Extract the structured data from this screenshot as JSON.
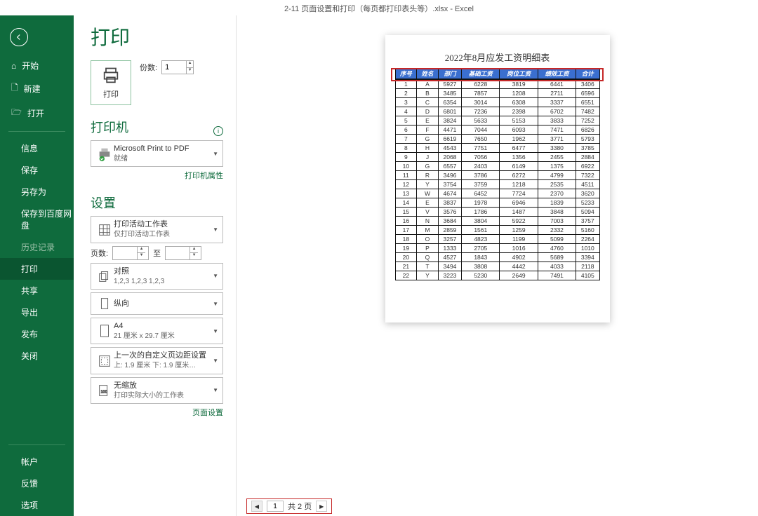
{
  "titlebar": "2-11 页面设置和打印（每页都打印表头等）.xlsx  -  Excel",
  "page_title": "打印",
  "print_btn": "打印",
  "copies_label": "份数:",
  "copies_value": "1",
  "section_printer": "打印机",
  "printer": {
    "name": "Microsoft Print to PDF",
    "status": "就绪"
  },
  "printer_props": "打印机属性",
  "section_settings": "设置",
  "dd_activesheet": {
    "t1": "打印活动工作表",
    "t2": "仅打印活动工作表"
  },
  "pages_label": "页数:",
  "pages_to": "至",
  "dd_collate": {
    "t1": "对照",
    "t2": "1,2,3    1,2,3    1,2,3"
  },
  "dd_orient": {
    "t1": "纵向"
  },
  "dd_paper": {
    "t1": "A4",
    "t2": "21 厘米 x 29.7 厘米"
  },
  "dd_margin": {
    "t1": "上一次的自定义页边距设置",
    "t2": "上: 1.9 厘米 下: 1.9 厘米…"
  },
  "dd_scale": {
    "t1": "无缩放",
    "t2": "打印实际大小的工作表"
  },
  "page_setup": "页面设置",
  "nav": {
    "start": "开始",
    "new": "新建",
    "open": "打开",
    "info": "信息",
    "save": "保存",
    "saveas": "另存为",
    "baidu": "保存到百度网盘",
    "history": "历史记录",
    "print": "打印",
    "share": "共享",
    "export": "导出",
    "publish": "发布",
    "close": "关闭",
    "account": "帐户",
    "feedback": "反馈",
    "options": "选项"
  },
  "pager": {
    "current": "1",
    "total": "共 2 页"
  },
  "chart_data": {
    "type": "table",
    "title": "2022年8月应发工资明细表",
    "columns": [
      "序号",
      "姓名",
      "部门",
      "基础工资",
      "岗位工资",
      "绩效工资",
      "合计"
    ],
    "rows": [
      [
        1,
        "A",
        5927,
        6228,
        3819,
        6441,
        3406
      ],
      [
        2,
        "B",
        3485,
        7857,
        1208,
        2711,
        6596
      ],
      [
        3,
        "C",
        6354,
        3014,
        6308,
        3337,
        6551
      ],
      [
        4,
        "D",
        6801,
        7236,
        2398,
        6702,
        7482
      ],
      [
        5,
        "E",
        3824,
        5633,
        5153,
        3833,
        7252
      ],
      [
        6,
        "F",
        4471,
        7044,
        6093,
        7471,
        6826
      ],
      [
        7,
        "G",
        6619,
        7650,
        1962,
        3771,
        5793
      ],
      [
        8,
        "H",
        4543,
        7751,
        6477,
        3380,
        3785
      ],
      [
        9,
        "J",
        2068,
        7056,
        1356,
        2455,
        2884
      ],
      [
        10,
        "G",
        6557,
        2403,
        6149,
        1375,
        6922
      ],
      [
        11,
        "R",
        3496,
        3786,
        6272,
        4799,
        7322
      ],
      [
        12,
        "Y",
        3754,
        3759,
        1218,
        2535,
        4511
      ],
      [
        13,
        "W",
        4674,
        6452,
        7724,
        2370,
        3620
      ],
      [
        14,
        "E",
        3837,
        1978,
        6946,
        1839,
        5233
      ],
      [
        15,
        "V",
        3576,
        1786,
        1487,
        3848,
        5094
      ],
      [
        16,
        "N",
        3684,
        3804,
        5922,
        7003,
        3757
      ],
      [
        17,
        "M",
        2859,
        1561,
        1259,
        2332,
        5160
      ],
      [
        18,
        "O",
        3257,
        4823,
        1199,
        5099,
        2264
      ],
      [
        19,
        "P",
        1333,
        2705,
        1016,
        4760,
        1010
      ],
      [
        20,
        "Q",
        4527,
        1843,
        4902,
        5689,
        3394
      ],
      [
        21,
        "T",
        3494,
        3808,
        4442,
        4033,
        2118
      ],
      [
        22,
        "Y",
        3223,
        5230,
        2649,
        7491,
        4105
      ]
    ]
  }
}
